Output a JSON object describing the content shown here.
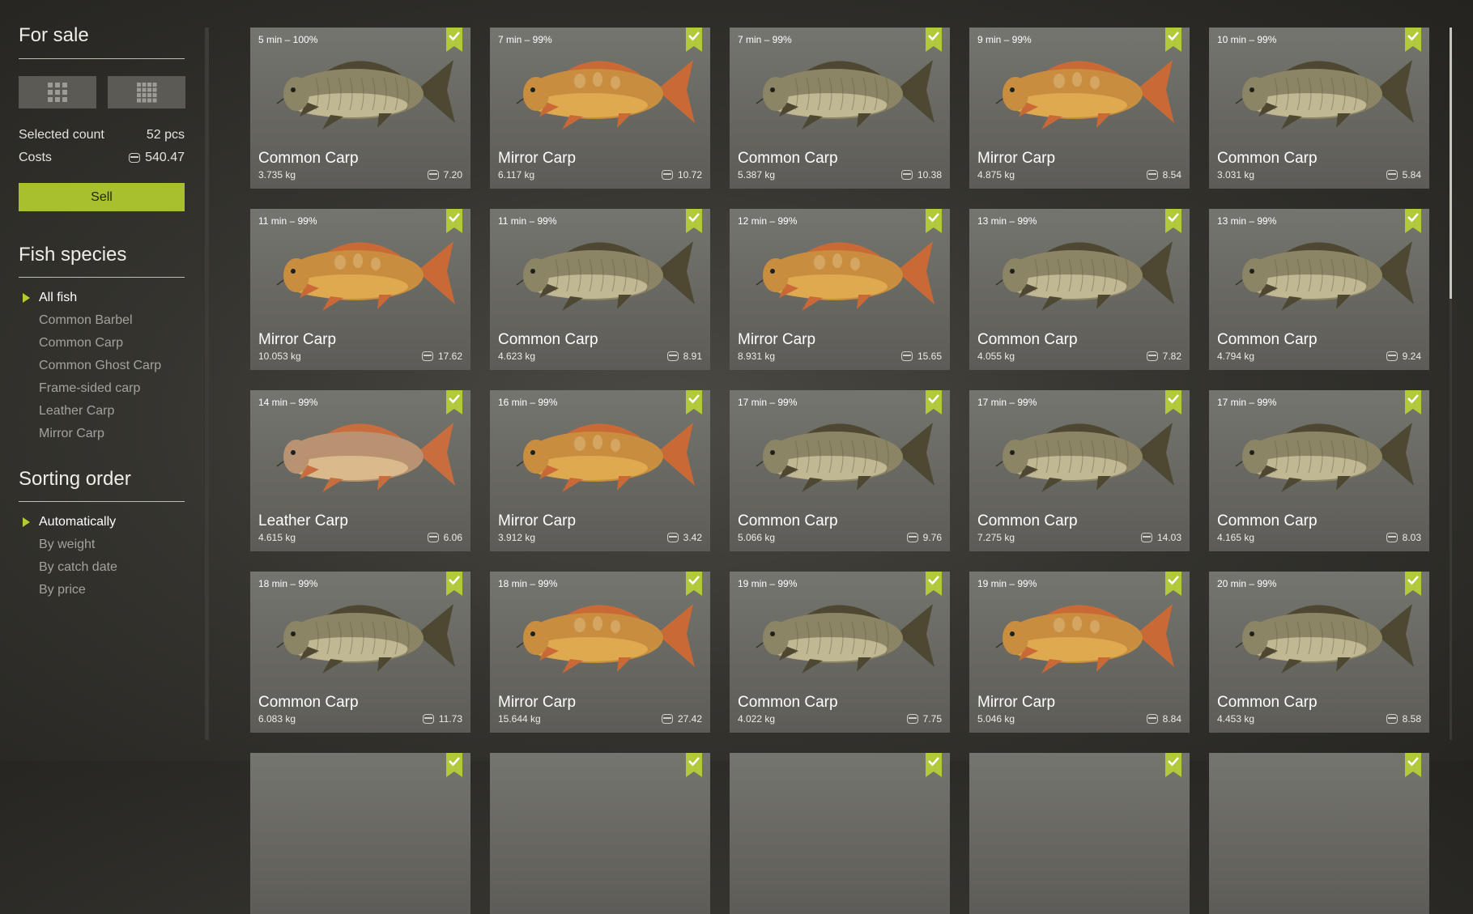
{
  "sidebar": {
    "title": "For sale",
    "selected_label": "Selected count",
    "selected_value": "52 pcs",
    "costs_label": "Costs",
    "costs_value": "540.47",
    "sell_label": "Sell",
    "species_title": "Fish species",
    "species": [
      "All fish",
      "Common Barbel",
      "Common Carp",
      "Common Ghost Carp",
      "Frame-sided carp",
      "Leather Carp",
      "Mirror Carp"
    ],
    "species_selected": "All fish",
    "sorting_title": "Sorting order",
    "sorting": [
      "Automatically",
      "By weight",
      "By catch date",
      "By price"
    ],
    "sorting_selected": "Automatically"
  },
  "fish_cards": [
    {
      "time": "5 min – 100%",
      "name": "Common Carp",
      "weight": "3.735 kg",
      "price": "7.20",
      "kind": "common"
    },
    {
      "time": "7 min – 99%",
      "name": "Mirror Carp",
      "weight": "6.117 kg",
      "price": "10.72",
      "kind": "mirror"
    },
    {
      "time": "7 min – 99%",
      "name": "Common Carp",
      "weight": "5.387 kg",
      "price": "10.38",
      "kind": "common"
    },
    {
      "time": "9 min – 99%",
      "name": "Mirror Carp",
      "weight": "4.875 kg",
      "price": "8.54",
      "kind": "mirror"
    },
    {
      "time": "10 min – 99%",
      "name": "Common Carp",
      "weight": "3.031 kg",
      "price": "5.84",
      "kind": "common"
    },
    {
      "time": "11 min – 99%",
      "name": "Mirror Carp",
      "weight": "10.053 kg",
      "price": "17.62",
      "kind": "mirror"
    },
    {
      "time": "11 min – 99%",
      "name": "Common Carp",
      "weight": "4.623 kg",
      "price": "8.91",
      "kind": "common"
    },
    {
      "time": "12 min – 99%",
      "name": "Mirror Carp",
      "weight": "8.931 kg",
      "price": "15.65",
      "kind": "mirror"
    },
    {
      "time": "13 min – 99%",
      "name": "Common Carp",
      "weight": "4.055 kg",
      "price": "7.82",
      "kind": "common"
    },
    {
      "time": "13 min – 99%",
      "name": "Common Carp",
      "weight": "4.794 kg",
      "price": "9.24",
      "kind": "common"
    },
    {
      "time": "14 min – 99%",
      "name": "Leather Carp",
      "weight": "4.615 kg",
      "price": "6.06",
      "kind": "leather"
    },
    {
      "time": "16 min – 99%",
      "name": "Mirror Carp",
      "weight": "3.912 kg",
      "price": "3.42",
      "kind": "mirror"
    },
    {
      "time": "17 min – 99%",
      "name": "Common Carp",
      "weight": "5.066 kg",
      "price": "9.76",
      "kind": "common"
    },
    {
      "time": "17 min – 99%",
      "name": "Common Carp",
      "weight": "7.275 kg",
      "price": "14.03",
      "kind": "common"
    },
    {
      "time": "17 min – 99%",
      "name": "Common Carp",
      "weight": "4.165 kg",
      "price": "8.03",
      "kind": "common"
    },
    {
      "time": "18 min – 99%",
      "name": "Common Carp",
      "weight": "6.083 kg",
      "price": "11.73",
      "kind": "common"
    },
    {
      "time": "18 min – 99%",
      "name": "Mirror Carp",
      "weight": "15.644 kg",
      "price": "27.42",
      "kind": "mirror"
    },
    {
      "time": "19 min – 99%",
      "name": "Common Carp",
      "weight": "4.022 kg",
      "price": "7.75",
      "kind": "common"
    },
    {
      "time": "19 min – 99%",
      "name": "Mirror Carp",
      "weight": "5.046 kg",
      "price": "8.84",
      "kind": "mirror"
    },
    {
      "time": "20 min – 99%",
      "name": "Common Carp",
      "weight": "4.453 kg",
      "price": "8.58",
      "kind": "common"
    },
    {
      "time": "",
      "name": "",
      "weight": "",
      "price": "",
      "kind": "partial"
    },
    {
      "time": "",
      "name": "",
      "weight": "",
      "price": "",
      "kind": "partial"
    },
    {
      "time": "",
      "name": "",
      "weight": "",
      "price": "",
      "kind": "partial"
    },
    {
      "time": "",
      "name": "",
      "weight": "",
      "price": "",
      "kind": "partial"
    },
    {
      "time": "",
      "name": "",
      "weight": "",
      "price": "",
      "kind": "partial"
    }
  ],
  "icons": {
    "selected_mark": "check-bookmark-icon",
    "price": "coin-stack-icon",
    "view_large": "grid-large-icon",
    "view_small": "grid-small-icon"
  },
  "colors": {
    "accent": "#a8bf2e",
    "check_bg": "#b1c93a",
    "card_bg": "#6a6964"
  }
}
